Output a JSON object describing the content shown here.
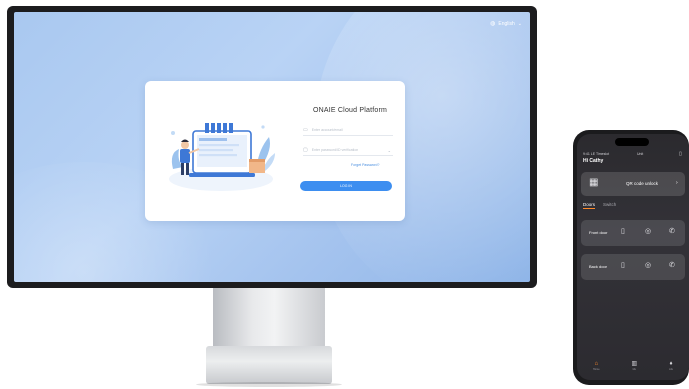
{
  "desktop": {
    "language": "English",
    "login": {
      "brand_title": "ONAIE Cloud Platform",
      "username_placeholder": "Enter account/email",
      "password_placeholder": "Enter password/ID verification",
      "forgot_label": "Forget Password?",
      "login_button": "LOG IN"
    }
  },
  "phone": {
    "status_left": "9:41 LE Timeslot",
    "status_right": "Unit",
    "greeting": "Hi Cathy",
    "qr_label": "QR code unlock",
    "tabs": [
      "Doors",
      "Switch"
    ],
    "doors": [
      {
        "name": "Front door"
      },
      {
        "name": "Back door"
      }
    ],
    "tabbar": [
      "Home",
      "Me",
      "Life"
    ]
  }
}
